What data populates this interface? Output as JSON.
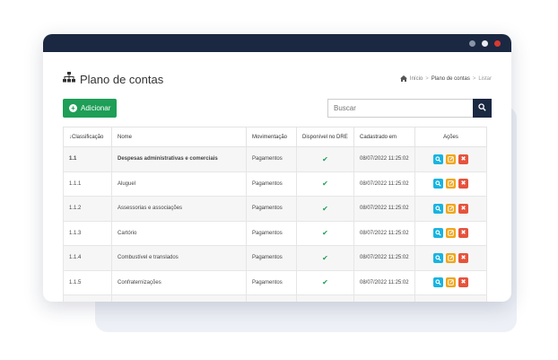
{
  "window": {
    "controls": [
      {
        "name": "window-dot-1",
        "color": "#8a94a8"
      },
      {
        "name": "window-dot-2",
        "color": "#e8ebf2"
      },
      {
        "name": "window-dot-3",
        "color": "#d63a32"
      }
    ]
  },
  "page": {
    "title": "Plano de contas",
    "title_icon": "sitemap-icon"
  },
  "breadcrumb": {
    "items": [
      "Início",
      "Plano de contas",
      "Listar"
    ],
    "home_icon": "home-icon"
  },
  "toolbar": {
    "add_label": "Adicionar",
    "search_placeholder": "Buscar"
  },
  "colors": {
    "primary": "#1e9e57",
    "dark": "#1b2842",
    "view": "#17b4e0",
    "edit": "#f0a61a",
    "delete": "#e5533d"
  },
  "table": {
    "headers": [
      "↓Classificação",
      "Nome",
      "Movimentação",
      "Disponível no DRE",
      "Cadastrado em",
      "Ações"
    ],
    "rows": [
      {
        "code": "1.1",
        "name": "Despesas administrativas e comerciais",
        "movement": "Pagamentos",
        "dre": "✔",
        "created": "08/07/2022 11:25:02"
      },
      {
        "code": "1.1.1",
        "name": "Aluguel",
        "movement": "Pagamentos",
        "dre": "✔",
        "created": "08/07/2022 11:25:02"
      },
      {
        "code": "1.1.2",
        "name": "Assessorias e associações",
        "movement": "Pagamentos",
        "dre": "✔",
        "created": "08/07/2022 11:25:02"
      },
      {
        "code": "1.1.3",
        "name": "Cartório",
        "movement": "Pagamentos",
        "dre": "✔",
        "created": "08/07/2022 11:25:02"
      },
      {
        "code": "1.1.4",
        "name": "Combustível e translados",
        "movement": "Pagamentos",
        "dre": "✔",
        "created": "08/07/2022 11:25:02"
      },
      {
        "code": "1.1.5",
        "name": "Confraternizações",
        "movement": "Pagamentos",
        "dre": "✔",
        "created": "08/07/2022 11:25:02"
      }
    ]
  }
}
